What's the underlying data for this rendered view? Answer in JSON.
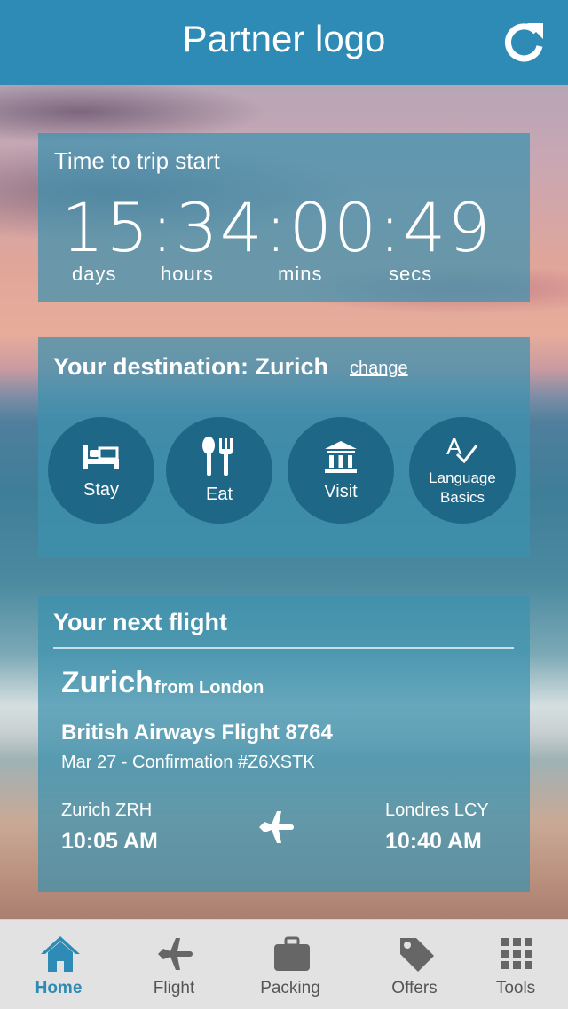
{
  "header": {
    "title": "Partner logo"
  },
  "countdown": {
    "label": "Time to trip start",
    "display": "15:34:00:49",
    "units": {
      "days": "days",
      "hours": "hours",
      "mins": "mins",
      "secs": "secs"
    }
  },
  "destination": {
    "title": "Your destination: Zurich",
    "change_label": "change",
    "items": [
      {
        "label": "Stay",
        "icon": "bed-icon"
      },
      {
        "label": "Eat",
        "icon": "utensils-icon"
      },
      {
        "label": "Visit",
        "icon": "landmark-icon"
      },
      {
        "label_line1": "Language",
        "label_line2": "Basics",
        "icon": "language-icon"
      }
    ]
  },
  "flight": {
    "heading": "Your next flight",
    "destination_city": "Zurich",
    "from": "from London",
    "airline": "British Airways Flight 8764",
    "date_confirmation": "Mar 27 - Confirmation #Z6XSTK",
    "departure": {
      "airport": "Zurich ZRH",
      "time": "10:05 AM"
    },
    "arrival": {
      "airport": "Londres LCY",
      "time": "10:40 AM"
    }
  },
  "tabs": [
    {
      "label": "Home",
      "icon": "home-icon",
      "active": true
    },
    {
      "label": "Flight",
      "icon": "airplane-icon",
      "active": false
    },
    {
      "label": "Packing",
      "icon": "suitcase-icon",
      "active": false
    },
    {
      "label": "Offers",
      "icon": "tag-icon",
      "active": false
    },
    {
      "label": "Tools",
      "icon": "grid-icon",
      "active": false
    }
  ],
  "colors": {
    "header": "#2e8bb5",
    "circle": "#1f6786",
    "tab_active": "#2e8bb5",
    "tab_inactive": "#555555"
  }
}
